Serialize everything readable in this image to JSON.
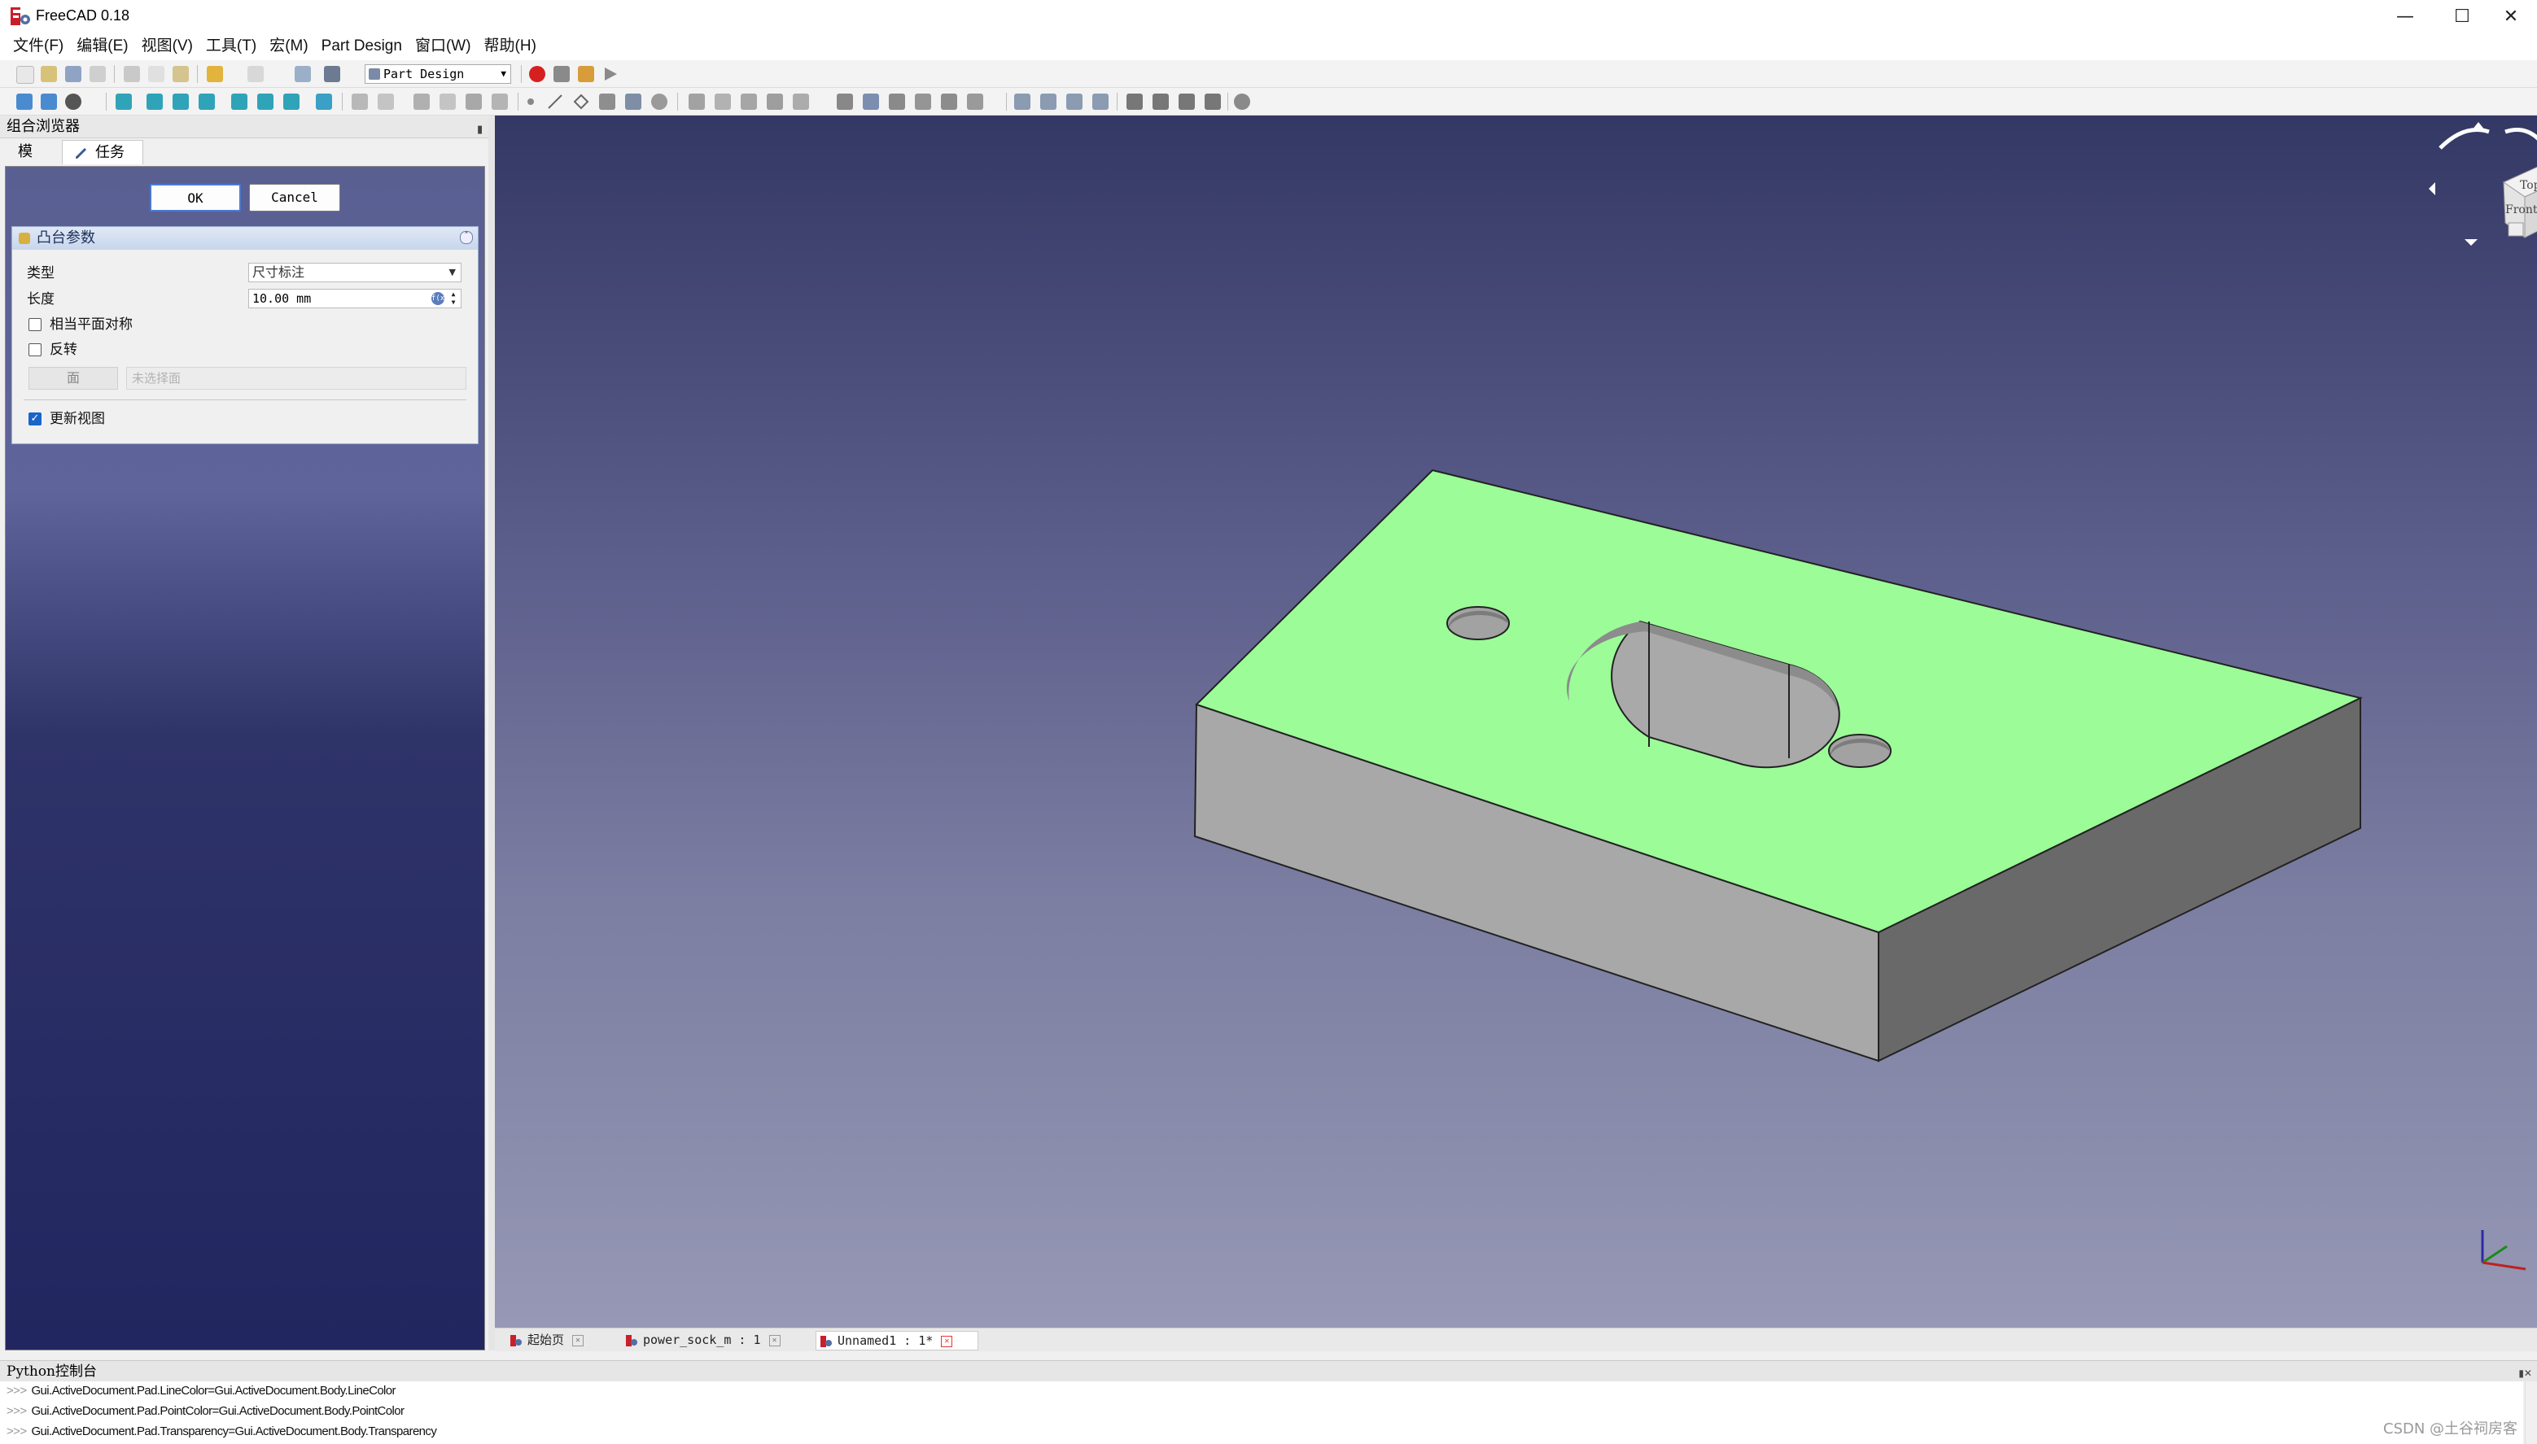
{
  "window": {
    "title": "FreeCAD 0.18",
    "controls": [
      "minimize",
      "maximize",
      "close"
    ]
  },
  "menubar": {
    "items": [
      "文件(F)",
      "编辑(E)",
      "视图(V)",
      "工具(T)",
      "宏(M)",
      "Part Design",
      "窗口(W)",
      "帮助(H)"
    ]
  },
  "toolbar": {
    "workbench": "Part Design"
  },
  "combo_view": {
    "title": "组合浏览器",
    "tabs": [
      "模型",
      "任务"
    ],
    "active_tab": "任务"
  },
  "task_panel": {
    "ok_label": "OK",
    "cancel_label": "Cancel",
    "section_title": "凸台参数",
    "type_label": "类型",
    "type_value": "尺寸标注",
    "length_label": "长度",
    "length_value": "10.00 mm",
    "symmetric_label": "相当平面对称",
    "symmetric_checked": false,
    "reversed_label": "反转",
    "reversed_checked": false,
    "face_button": "面",
    "face_placeholder": "未选择面",
    "update_view_label": "更新视图",
    "update_view_checked": true
  },
  "viewport": {
    "navcube_top": "Top",
    "navcube_front": "Front",
    "top_face_color": "#9cfc98",
    "side_face_color": "#a4a4a4",
    "dark_face_color": "#6e6e6e"
  },
  "doc_tabs": [
    {
      "label": "起始页"
    },
    {
      "label": "power_sock_m : 1"
    },
    {
      "label": "Unnamed1 : 1*"
    }
  ],
  "python_console": {
    "title": "Python控制台",
    "lines": [
      "Gui.ActiveDocument.Pad.LineColor=Gui.ActiveDocument.Body.LineColor",
      "Gui.ActiveDocument.Pad.PointColor=Gui.ActiveDocument.Body.PointColor",
      "Gui.ActiveDocument.Pad.Transparency=Gui.ActiveDocument.Body.Transparency"
    ],
    "prompt": ">>>"
  },
  "watermark": "CSDN @土谷祠房客"
}
